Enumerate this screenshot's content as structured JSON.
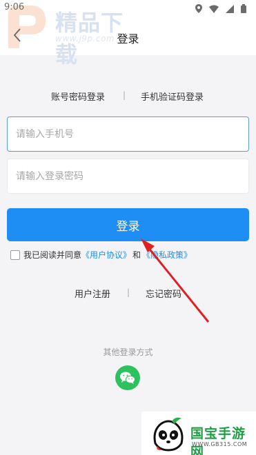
{
  "status_bar": {
    "time": "9:06"
  },
  "watermark": {
    "text": "精品下载",
    "url": "www.j9p.com"
  },
  "header": {
    "title": "登录"
  },
  "tabs": {
    "password_login": "账号密码登录",
    "sms_login": "手机验证码登录"
  },
  "form": {
    "phone_placeholder": "请输入手机号",
    "password_placeholder": "请输入登录密码",
    "login_button": "登录"
  },
  "agreement": {
    "prefix": "我已阅读并同意",
    "user_agreement": "《用户协议》",
    "and": "和",
    "privacy_policy": "《隐私政策》"
  },
  "links": {
    "register": "用户注册",
    "forgot_password": "忘记密码"
  },
  "other_login": {
    "label": "其他登录方式"
  },
  "brand": {
    "name": "国宝手游网",
    "url": "WWW.GB315.COM"
  },
  "colors": {
    "accent": "#1e8ef5",
    "wechat": "#2ec160",
    "annotation_arrow": "#e02020"
  }
}
